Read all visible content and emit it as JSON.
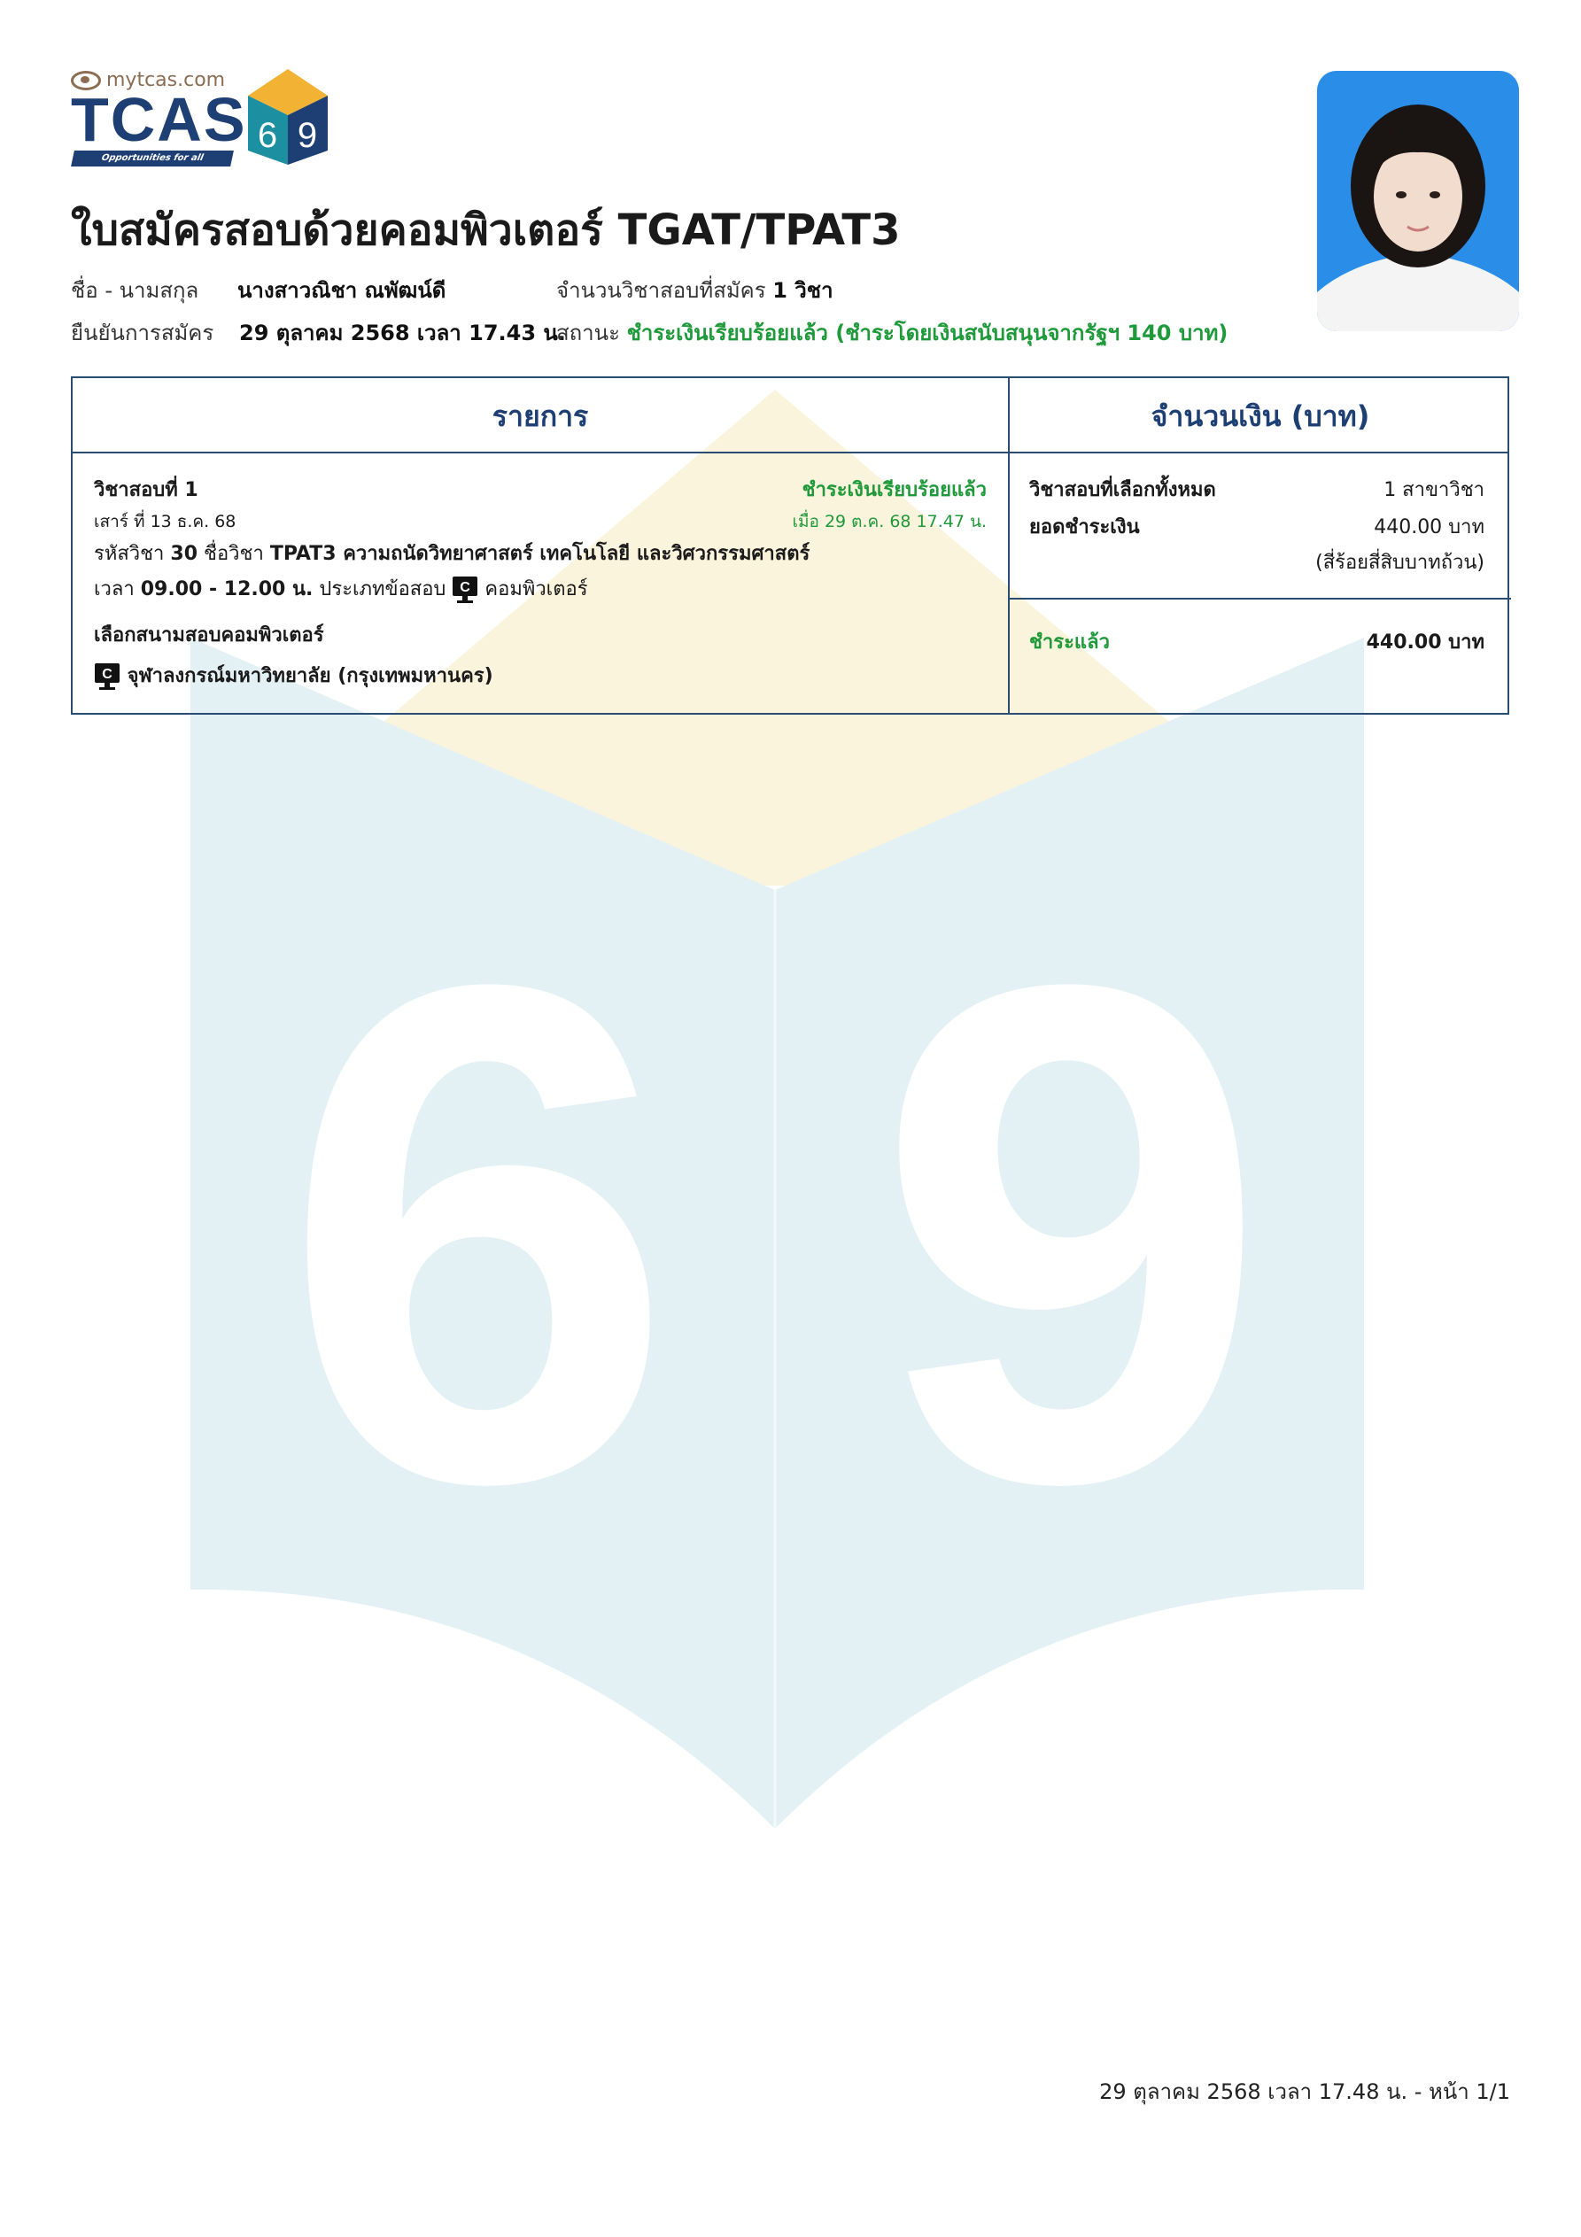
{
  "logo": {
    "site": "mytcas.com",
    "brand": "TCAS",
    "badge_number": "69",
    "tagline": "Opportunities for all"
  },
  "document": {
    "title": "ใบสมัครสอบด้วยคอมพิวเตอร์ TGAT/TPAT3",
    "info": {
      "name_label": "ชื่อ - นามสกุล",
      "name_value": "นางสาวณิชา ณพัฒน์ดี",
      "confirm_label": "ยืนยันการสมัคร",
      "confirm_value": "29 ตุลาคม 2568 เวลา 17.43 น.",
      "count_label": "จำนวนวิชาสอบที่สมัคร",
      "count_value": "1 วิชา",
      "status_label": "สถานะ",
      "status_value": "ชำระเงินเรียบร้อยแล้ว (ชำระโดยเงินสนับสนุนจากรัฐฯ 140 บาท)"
    }
  },
  "table": {
    "header_items": "รายการ",
    "header_amount": "จำนวนเงิน (บาท)",
    "item": {
      "subject_title": "วิชาสอบที่ 1",
      "date": "เสาร์ ที่ 13 ธ.ค. 68",
      "payment_status": "ชำระเงินเรียบร้อยแล้ว",
      "payment_time": "เมื่อ 29 ต.ค. 68 17.47 น.",
      "code_prefix": "รหัสวิชา",
      "code_value": "30",
      "name_prefix": "ชื่อวิชา",
      "name_value": "TPAT3 ความถนัดวิทยาศาสตร์ เทคโนโลยี และวิศวกรรมศาสตร์",
      "time_prefix": "เวลา",
      "time_value": "09.00 - 12.00 น.",
      "type_prefix": "ประเภทข้อสอบ",
      "type_value": "คอมพิวเตอร์",
      "venue_heading": "เลือกสนามสอบคอมพิวเตอร์",
      "venue_value": "จุฬาลงกรณ์มหาวิทยาลัย (กรุงเทพมหานคร)"
    },
    "summary": {
      "subjects_label": "วิชาสอบที่เลือกทั้งหมด",
      "subjects_value": "1 สาขาวิชา",
      "total_label": "ยอดชำระเงิน",
      "total_value": "440.00 บาท",
      "total_words": "(สี่ร้อยสี่สิบบาทถ้วน)",
      "paid_label": "ชำระแล้ว",
      "paid_value": "440.00 บาท"
    }
  },
  "footer": {
    "text": "29 ตุลาคม 2568 เวลา 17.48 น. - หน้า 1/1"
  },
  "colors": {
    "navy": "#1d3f74",
    "border": "#2a4b72",
    "green": "#1f9a3a",
    "watermark_blue": "#e2f0f4",
    "watermark_yellow": "#fbf4dc"
  }
}
